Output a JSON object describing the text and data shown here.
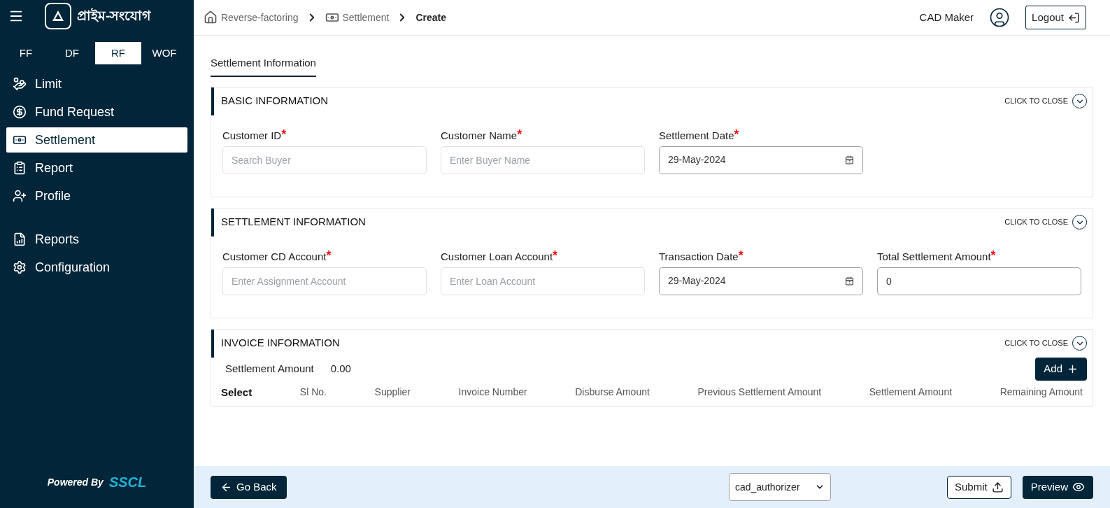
{
  "sidebar": {
    "logo_text": "প্রাইম-সংযোগ",
    "module_tabs": [
      {
        "label": "FF",
        "selected": false
      },
      {
        "label": "DF",
        "selected": false
      },
      {
        "label": "RF",
        "selected": true
      },
      {
        "label": "WOF",
        "selected": false
      }
    ],
    "nav_groups": [
      [
        {
          "label": "Limit",
          "selected": false
        },
        {
          "label": "Fund Request",
          "selected": false
        },
        {
          "label": "Settlement",
          "selected": true
        },
        {
          "label": "Report",
          "selected": false
        },
        {
          "label": "Profile",
          "selected": false
        }
      ],
      [
        {
          "label": "Reports",
          "selected": false
        },
        {
          "label": "Configuration",
          "selected": false
        }
      ]
    ],
    "footer": {
      "powered_by": "Powered By",
      "brand": "SSCL"
    }
  },
  "breadcrumb": [
    {
      "label": "Reverse-factoring",
      "current": false
    },
    {
      "label": "Settlement",
      "current": false
    },
    {
      "label": "Create",
      "current": true
    }
  ],
  "header": {
    "user_name": "CAD Maker",
    "logout": "Logout"
  },
  "page_tabs": [
    {
      "label": "Settlement Information",
      "selected": true
    }
  ],
  "sections": [
    {
      "title": "BASIC INFORMATION",
      "toggle": "CLICK TO CLOSE",
      "fields": [
        {
          "kind": "text",
          "label": "Customer ID",
          "required_mark": "*",
          "placeholder": "Search Buyer"
        },
        {
          "kind": "text",
          "label": "Customer Name",
          "required_mark": "*",
          "placeholder": "Enter Buyer Name"
        },
        {
          "kind": "date",
          "label": "Settlement Date",
          "required_mark": "*",
          "value": "29-May-2024"
        }
      ]
    },
    {
      "title": "SETTLEMENT INFORMATION",
      "toggle": "CLICK TO CLOSE",
      "fields": [
        {
          "kind": "text",
          "label": "Customer CD Account",
          "required_mark": "*",
          "placeholder": "Enter Assignment Account"
        },
        {
          "kind": "text",
          "label": "Customer Loan Account",
          "required_mark": "*",
          "placeholder": "Enter Loan Account"
        },
        {
          "kind": "date",
          "label": "Transaction Date",
          "required_mark": "*",
          "value": "29-May-2024"
        },
        {
          "kind": "text",
          "label": "Total Settlement Amount",
          "required_mark": "*",
          "value": "0"
        }
      ]
    }
  ],
  "invoice": {
    "title": "INVOICE INFORMATION",
    "toggle": "CLICK TO CLOSE",
    "amount_label": "Settlement Amount",
    "amount": "0.00",
    "add": "Add",
    "columns": [
      "Select",
      "Sl No.",
      "Supplier",
      "Invoice Number",
      "Disburse Amount",
      "Previous Settlement Amount",
      "Settlement Amount",
      "Remaining Amount"
    ]
  },
  "footer": {
    "go_back": "Go Back",
    "role": "cad_authorizer",
    "submit": "Submit",
    "preview": "Preview"
  }
}
